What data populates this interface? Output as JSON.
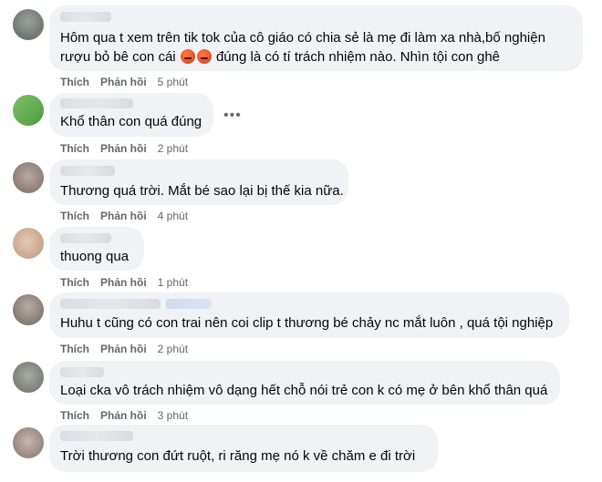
{
  "colors": {
    "bubble": "#f0f2f5",
    "text": "#050505",
    "meta": "#65676b"
  },
  "labels": {
    "like": "Thích",
    "reply": "Phản hồi"
  },
  "more_icon": "•••",
  "comments": [
    {
      "lines": [
        "Hôm qua t xem trên tik tok của cô giáo có chia sẻ là mẹ đi làm xa nhà,bố nghiện",
        "rượu bỏ bê con cái",
        "đúng là có tí trách nhiệm nào. Nhìn tội con ghê"
      ],
      "emojis": [
        "angry-face-emoji",
        "angry-face-emoji"
      ],
      "time": "5 phút"
    },
    {
      "lines": [
        "Khổ thân con quá đúng"
      ],
      "time": "2 phút"
    },
    {
      "lines": [
        "Thương quá trời. Mắt bé sao lại bị thế kia nữa."
      ],
      "time": "4 phút"
    },
    {
      "lines": [
        "thuong qua"
      ],
      "time": "1 phút"
    },
    {
      "lines": [
        "Huhu t cũng có con trai nên coi clip t thương bé chảy nc mắt luôn , quá tội nghiệp"
      ],
      "time": "2 phút"
    },
    {
      "lines": [
        "Loại cka vô trách nhiệm vô dạng hết chỗ nói trẻ con k có mẹ ở bên khổ thân quá"
      ],
      "time": "3 phút"
    },
    {
      "lines": [
        "Trời thương con đứt ruột, ri răng mẹ nó k về chăm e đi trời"
      ]
    }
  ]
}
